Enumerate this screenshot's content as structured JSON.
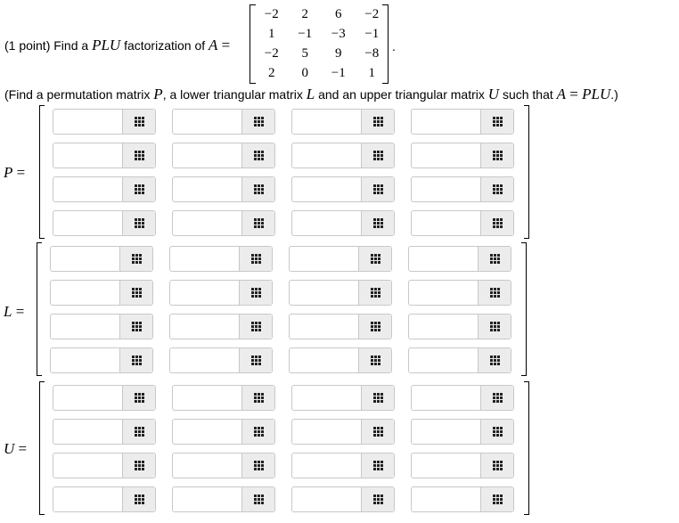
{
  "intro": {
    "points": "(1 point) Find a ",
    "plu": "PLU",
    "factorization_of": " factorization of ",
    "a_var": "A",
    "eq": " ="
  },
  "matrix_a": [
    [
      "−2",
      "2",
      "6",
      "−2"
    ],
    [
      "1",
      "−1",
      "−3",
      "−1"
    ],
    [
      "−2",
      "5",
      "9",
      "−8"
    ],
    [
      "2",
      "0",
      "−1",
      "1"
    ]
  ],
  "period": ".",
  "instruction": {
    "t1": "(Find a permutation matrix ",
    "p": "P",
    "t2": ", a lower triangular matrix ",
    "l": "L",
    "t3": " and an upper triangular matrix ",
    "u": "U",
    "t4": " such that ",
    "a": "A",
    "eq": " = ",
    "plu": "PLU",
    "t5": ".)"
  },
  "matrices": [
    {
      "var": "P",
      "eq": " ="
    },
    {
      "var": "L",
      "eq": " ="
    },
    {
      "var": "U",
      "eq": " ="
    }
  ],
  "matrix_button_icon": "grid-icon"
}
